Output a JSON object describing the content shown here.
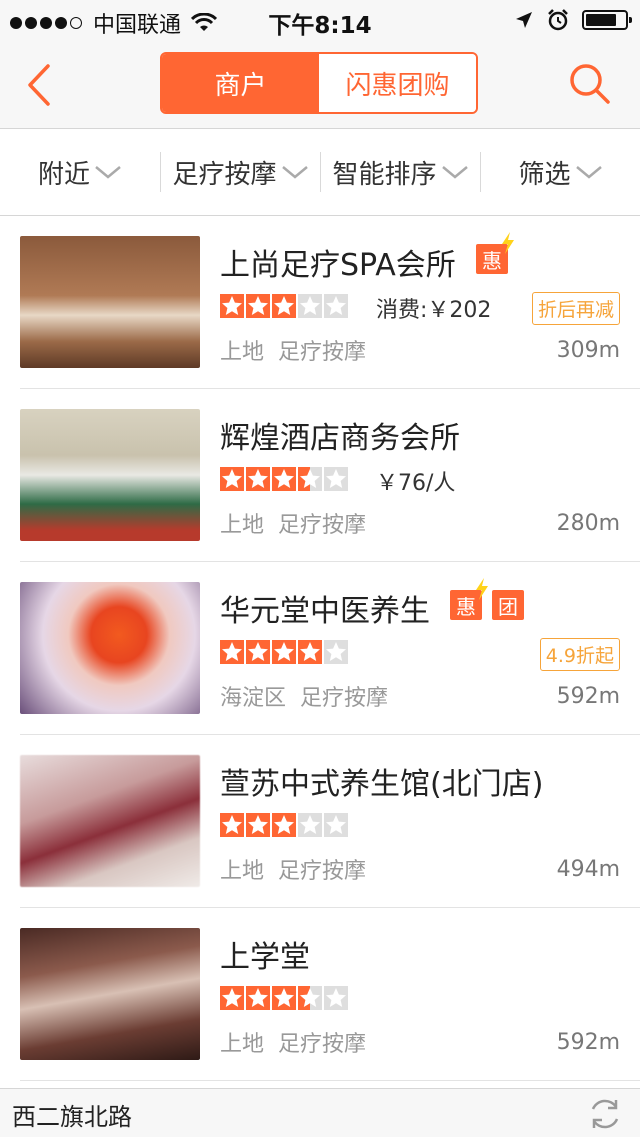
{
  "status_bar": {
    "carrier": "中国联通",
    "time": "下午8:14",
    "battery_level": 0.8
  },
  "nav": {
    "tabs": [
      {
        "label": "商户",
        "active": true
      },
      {
        "label": "闪惠团购",
        "active": false
      }
    ],
    "accent_color": "#ff6633"
  },
  "filters": [
    {
      "label": "附近"
    },
    {
      "label": "足疗按摩"
    },
    {
      "label": "智能排序"
    },
    {
      "label": "筛选"
    }
  ],
  "listings": [
    {
      "name": "上尚足疗SPA会所",
      "badges": [
        {
          "label": "惠",
          "bolt": true
        }
      ],
      "rating": 3,
      "price": "消费:￥202",
      "promo": "折后再减",
      "district": "上地",
      "category": "足疗按摩",
      "distance": "309m"
    },
    {
      "name": "辉煌酒店商务会所",
      "badges": [],
      "rating": 3.5,
      "price": "￥76/人",
      "promo": "",
      "district": "上地",
      "category": "足疗按摩",
      "distance": "280m"
    },
    {
      "name": "华元堂中医养生",
      "badges": [
        {
          "label": "惠",
          "bolt": true
        },
        {
          "label": "团",
          "bolt": false
        }
      ],
      "rating": 4,
      "price": "",
      "promo": "4.9折起",
      "district": "海淀区",
      "category": "足疗按摩",
      "distance": "592m"
    },
    {
      "name": "萱苏中式养生馆(北门店)",
      "badges": [],
      "rating": 3,
      "price": "",
      "promo": "",
      "district": "上地",
      "category": "足疗按摩",
      "distance": "494m"
    },
    {
      "name": "上学堂",
      "badges": [],
      "rating": 3.5,
      "price": "",
      "promo": "",
      "district": "上地",
      "category": "足疗按摩",
      "distance": "592m"
    }
  ],
  "bottom_bar": {
    "location": "西二旗北路"
  }
}
